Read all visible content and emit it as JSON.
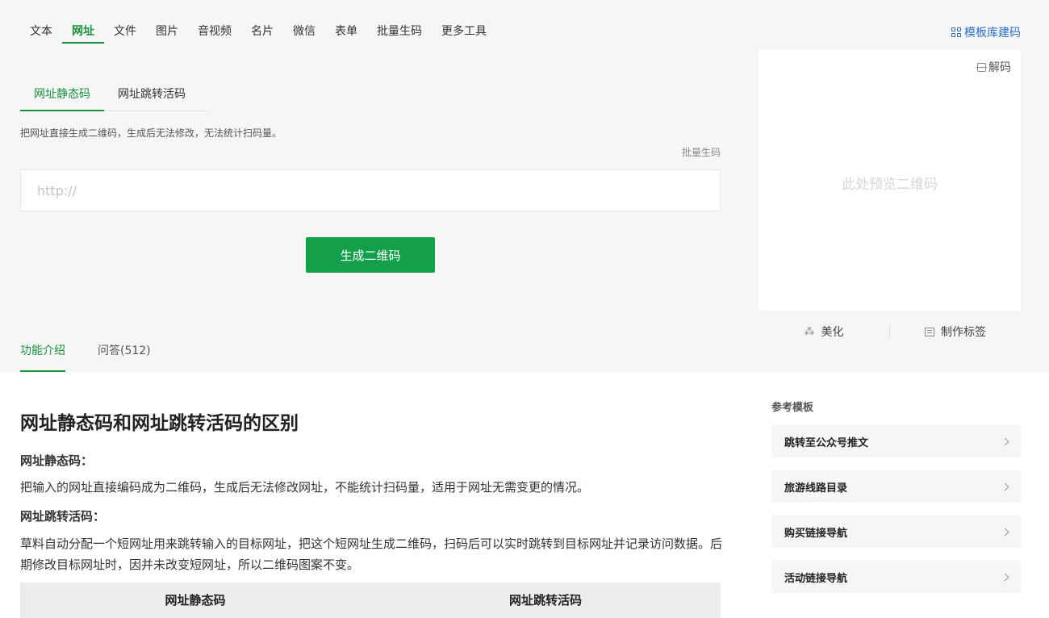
{
  "nav": {
    "items": [
      "文本",
      "网址",
      "文件",
      "图片",
      "音视频",
      "名片",
      "微信",
      "表单",
      "批量生码",
      "更多工具"
    ],
    "active_index": 1,
    "template_link": "模板库建码"
  },
  "subtabs": [
    "网址静态码",
    "网址跳转活码"
  ],
  "description": "把网址直接生成二维码，生成后无法修改，无法统计扫码量。",
  "batch_link": "批量生码",
  "url_input": {
    "value": "",
    "placeholder": "http://"
  },
  "generate_button": "生成二维码",
  "preview": {
    "decode_label": "解码",
    "hint": "此处预览二维码"
  },
  "tools": {
    "beautify": "美化",
    "make_label": "制作标签"
  },
  "bottom_tabs": [
    "功能介绍",
    "问答(512)"
  ],
  "article": {
    "title": "网址静态码和网址跳转活码的区别",
    "static_label": "网址静态码：",
    "static_text": "把输入的网址直接编码成为二维码，生成后无法修改网址，不能统计扫码量，适用于网址无需变更的情况。",
    "dynamic_label": "网址跳转活码：",
    "dynamic_text": "草料自动分配一个短网址用来跳转输入的目标网址，把这个短网址生成二维码，扫码后可以实时跳转到目标网址并记录访问数据。后期修改目标网址时，因并未改变短网址，所以二维码图案不变。",
    "compare_headers": [
      "网址静态码",
      "网址跳转活码"
    ]
  },
  "sidebar": {
    "title": "参考模板",
    "items": [
      "跳转至公众号推文",
      "旅游线路目录",
      "购买链接导航",
      "活动链接导航"
    ]
  },
  "colors": {
    "accent": "#1a8f3c",
    "button": "#14a04a",
    "link": "#2d6cc6"
  }
}
